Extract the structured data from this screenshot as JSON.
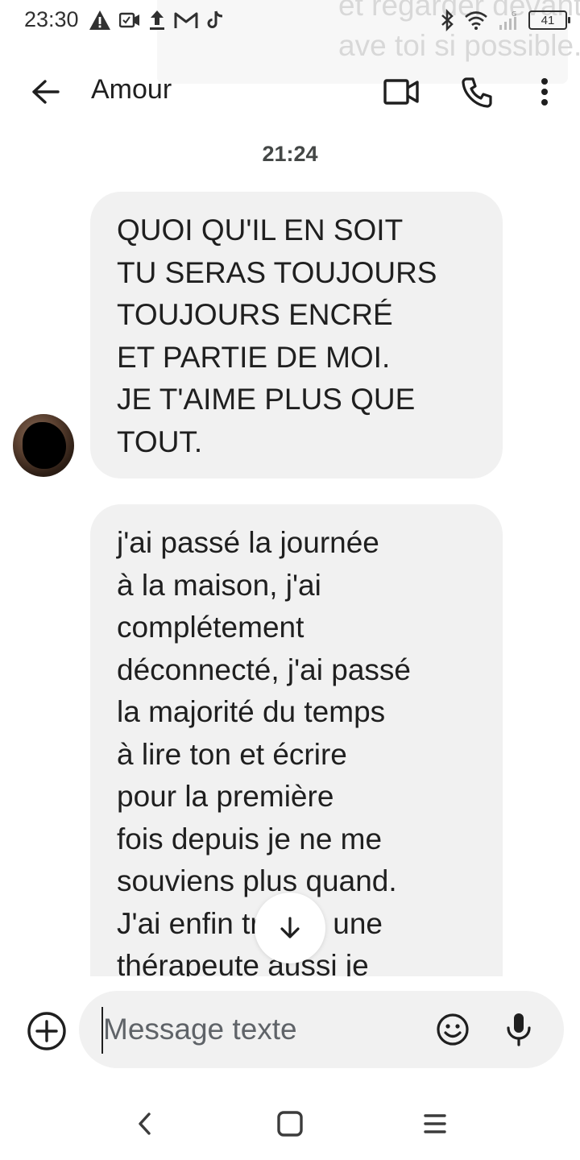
{
  "status_bar": {
    "time": "23:30",
    "battery": "41",
    "notification_ghost": [
      "et regarder devant",
      "ave toi si possible..."
    ]
  },
  "app_bar": {
    "title": "Amour"
  },
  "conversation": {
    "timestamp": "21:24",
    "messages": [
      {
        "sender": "contact",
        "text": "QUOI QU'IL EN SOIT\nTU SERAS TOUJOURS\nTOUJOURS ENCRÉ\nET PARTIE DE MOI.\nJE T'AIME PLUS QUE\nTOUT."
      },
      {
        "sender": "contact",
        "text": "j'ai passé la journée\nà la maison, j'ai\ncomplétement\ndéconnecté, j'ai passé\nla majorité du temps\nà lire ton et écrire\npour la première\nfois depuis je ne me\nsouviens plus quand.\nJ'ai enfin trouvé une\nthérapeute aussi je"
      }
    ]
  },
  "compose": {
    "placeholder": "Message texte",
    "value": ""
  },
  "colors": {
    "bubble": "#f1f1f1",
    "text": "#1f1f1f",
    "background": "#ffffff"
  }
}
